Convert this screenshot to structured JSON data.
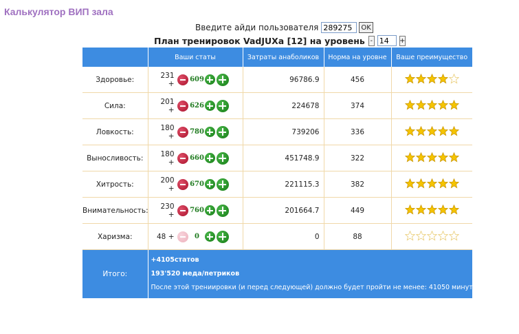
{
  "page_title": "Калькулятор ВИП зала",
  "user_form": {
    "label": "Введите айди пользователя",
    "user_id": "289275",
    "ok_label": "OK"
  },
  "plan": {
    "title": "План тренировок VadJUXa [12] на уровень",
    "minus_label": "-",
    "level": "14",
    "plus_label": "+"
  },
  "table": {
    "headers": [
      "",
      "Ваши статы",
      "Затраты анаболиков",
      "Норма на уровне",
      "Ваше преимущество"
    ],
    "rows": [
      {
        "name": "Здоровье:",
        "base": "231 +",
        "gain": "609",
        "cost": "96786.9",
        "norm": "456",
        "stars": 4,
        "minus_enabled": true
      },
      {
        "name": "Сила:",
        "base": "201 +",
        "gain": "626",
        "cost": "224678",
        "norm": "374",
        "stars": 5,
        "minus_enabled": true
      },
      {
        "name": "Ловкость:",
        "base": "180 +",
        "gain": "780",
        "cost": "739206",
        "norm": "336",
        "stars": 5,
        "minus_enabled": true
      },
      {
        "name": "Выносливость:",
        "base": "180 +",
        "gain": "660",
        "cost": "451748.9",
        "norm": "322",
        "stars": 5,
        "minus_enabled": true
      },
      {
        "name": "Хитрость:",
        "base": "200 +",
        "gain": "670",
        "cost": "221115.3",
        "norm": "382",
        "stars": 5,
        "minus_enabled": true
      },
      {
        "name": "Внимательность:",
        "base": "230 +",
        "gain": "760",
        "cost": "201664.7",
        "norm": "449",
        "stars": 5,
        "minus_enabled": true
      },
      {
        "name": "Харизма:",
        "base": "48 +",
        "gain": "0",
        "cost": "0",
        "norm": "88",
        "stars": 0,
        "minus_enabled": false
      }
    ],
    "stars_max": 5
  },
  "totals": {
    "label": "Итого:",
    "stats": "+4105статов",
    "honey": "193'520 меда/петриков",
    "note": "После этой трениировки (и перед следующей) должно будет пройти не менее: 41050 минут"
  },
  "colors": {
    "header_bg": "#3d8ce1",
    "title": "#9f70c0",
    "gain": "#1d7a1d",
    "norm": "#9a6a24",
    "star": "#f5c400"
  },
  "icons": {
    "minus": "minus-circle-icon",
    "plus_small": "plus-circle-icon",
    "plus_large": "plus-circle-large-icon",
    "star": "star-icon"
  }
}
